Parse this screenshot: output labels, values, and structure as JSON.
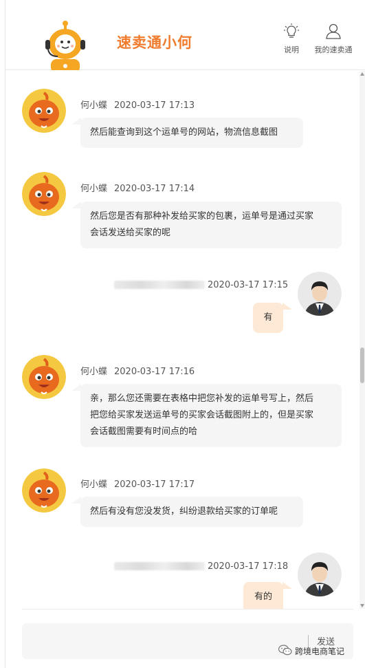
{
  "header": {
    "title": "速卖通小何",
    "help_label": "说明",
    "mine_label": "我的速卖通",
    "icons": [
      "robot-logo",
      "bulb-icon",
      "user-icon"
    ]
  },
  "messages": [
    {
      "sender": "何小蝶",
      "time": "2020-03-17 17:13",
      "direction": "in",
      "lines": [
        "然后能查询到这个运单号的网站，物流信息截图"
      ]
    },
    {
      "sender": "何小蝶",
      "time": "2020-03-17 17:14",
      "direction": "in",
      "lines": [
        "然后您是否有那种补发给买家的包裹，运单号是通过买家",
        "会话发送给买家的呢"
      ]
    },
    {
      "sender": "",
      "time": "2020-03-17 17:15",
      "direction": "out",
      "lines": [
        "有"
      ]
    },
    {
      "sender": "何小蝶",
      "time": "2020-03-17 17:16",
      "direction": "in",
      "lines": [
        "亲，那么您还需要在表格中把您补发的运单号写上，然后",
        "把您给买家发送运单号的买家会话截图附上的，但是买家",
        "会话截图需要有时间点的哈"
      ]
    },
    {
      "sender": "何小蝶",
      "time": "2020-03-17 17:17",
      "direction": "in",
      "lines": [
        "然后有没有您没发货，纠纷退款给买家的订单呢"
      ]
    },
    {
      "sender": "",
      "time": "2020-03-17 17:18",
      "direction": "out",
      "lines": [
        "有的"
      ]
    }
  ],
  "composer": {
    "send_label": "发送"
  },
  "watermark": {
    "text": "跨境电商笔记"
  },
  "colors": {
    "accent": "#f07b2c",
    "incoming_bubble": "#f5f5f5",
    "outgoing_bubble": "#fde9d5"
  }
}
